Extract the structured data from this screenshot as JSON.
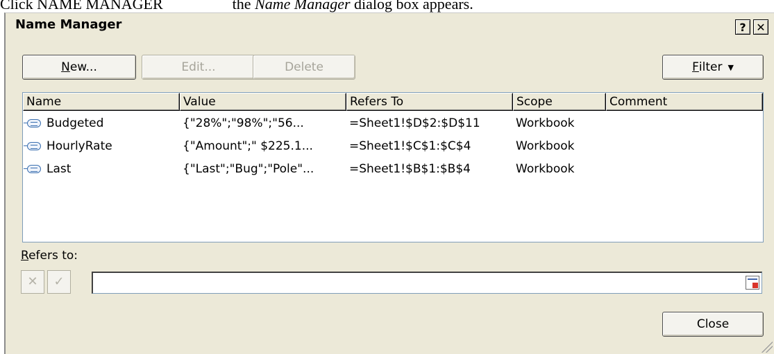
{
  "caption": {
    "lead": "Click NAME MANAGER",
    "rest_prefix": "the ",
    "rest_italic": "Name Manager",
    "rest_suffix": " dialog box appears."
  },
  "dialog": {
    "title": "Name Manager",
    "help_label": "?",
    "close_label": "✕"
  },
  "toolbar": {
    "new": {
      "mnemonic": "N",
      "rest": "ew..."
    },
    "edit_label": "Edit...",
    "delete_label": "Delete",
    "filter": {
      "mnemonic": "F",
      "rest": "ilter",
      "arrow": "▼"
    }
  },
  "list": {
    "columns": [
      "Name",
      "Value",
      "Refers To",
      "Scope",
      "Comment"
    ],
    "rows": [
      {
        "name": "Budgeted",
        "value": "{\"28%\";\"98%\";\"56...",
        "refers_to": "=Sheet1!$D$2:$D$11",
        "scope": "Workbook",
        "comment": ""
      },
      {
        "name": "HourlyRate",
        "value": "{\"Amount\";\" $225.1...",
        "refers_to": "=Sheet1!$C$1:$C$4",
        "scope": "Workbook",
        "comment": ""
      },
      {
        "name": "Last",
        "value": "{\"Last\";\"Bug\";\"Pole\"...",
        "refers_to": "=Sheet1!$B$1:$B$4",
        "scope": "Workbook",
        "comment": ""
      }
    ]
  },
  "refers_to": {
    "label_mnemonic": "R",
    "label_rest": "efers to:",
    "value": "",
    "cancel_glyph": "✕",
    "accept_glyph": "✓"
  },
  "footer": {
    "close_label": "Close"
  },
  "icons": {
    "name_icon": "named-range-icon",
    "collapse_icon": "collapse-dialog-icon"
  }
}
